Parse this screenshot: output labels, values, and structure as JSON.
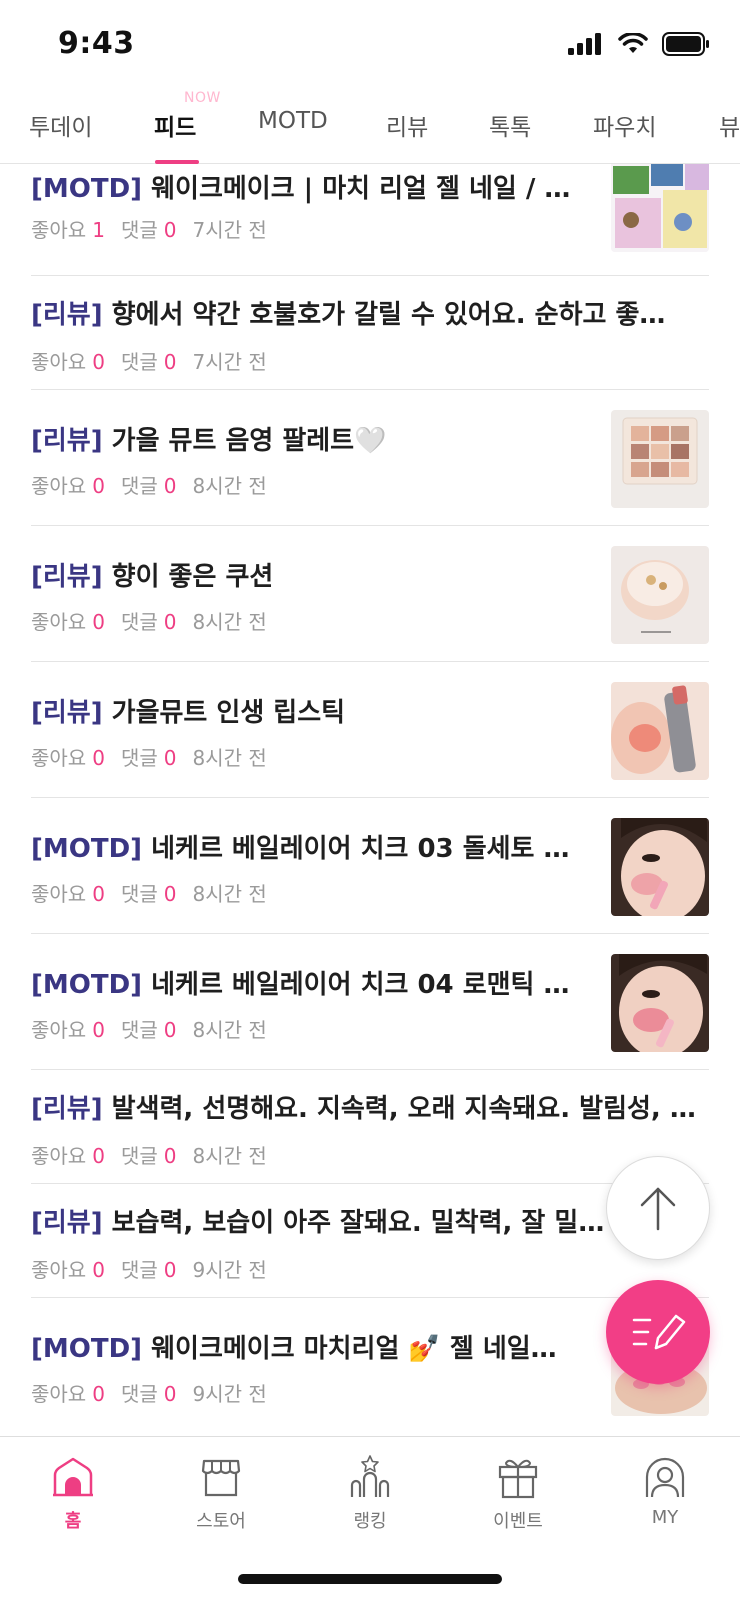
{
  "status_bar": {
    "time": "9:43"
  },
  "top_tabs": [
    {
      "label": "투데이",
      "badge": ""
    },
    {
      "label": "피드",
      "badge": "NOW"
    },
    {
      "label": "MOTD",
      "badge": ""
    },
    {
      "label": "리뷰",
      "badge": ""
    },
    {
      "label": "톡톡",
      "badge": ""
    },
    {
      "label": "파우치",
      "badge": ""
    },
    {
      "label": "뷰",
      "badge": ""
    }
  ],
  "feed": {
    "like_label": "좋아요",
    "comment_label": "댓글",
    "items": [
      {
        "tag": "[MOTD]",
        "title": " 웨이크메이크 | 마치 리얼 젤 네일 / …",
        "likes": "1",
        "comments": "0",
        "time": "7시간 전",
        "thumb": "nail-boxes"
      },
      {
        "tag": "[리뷰]",
        "title": " 향에서 약간 호불호가 갈릴 수 있어요. 순하고 좋…",
        "likes": "0",
        "comments": "0",
        "time": "7시간 전",
        "thumb": ""
      },
      {
        "tag": "[리뷰]",
        "title": " 가을 뮤트 음영 팔레트🤍",
        "likes": "0",
        "comments": "0",
        "time": "8시간 전",
        "thumb": "palette"
      },
      {
        "tag": "[리뷰]",
        "title": " 향이 좋은 쿠션",
        "likes": "0",
        "comments": "0",
        "time": "8시간 전",
        "thumb": "cushion"
      },
      {
        "tag": "[리뷰]",
        "title": " 가을뮤트 인생 립스틱",
        "likes": "0",
        "comments": "0",
        "time": "8시간 전",
        "thumb": "lipstick"
      },
      {
        "tag": "[MOTD]",
        "title": " 네케르 베일레이어 치크 03 돌세토 …",
        "likes": "0",
        "comments": "0",
        "time": "8시간 전",
        "thumb": "face"
      },
      {
        "tag": "[MOTD]",
        "title": " 네케르 베일레이어 치크 04 로맨틱 …",
        "likes": "0",
        "comments": "0",
        "time": "8시간 전",
        "thumb": "face"
      },
      {
        "tag": "[리뷰]",
        "title": " 발색력, 선명해요. 지속력, 오래 지속돼요. 발림성, …",
        "likes": "0",
        "comments": "0",
        "time": "8시간 전",
        "thumb": ""
      },
      {
        "tag": "[리뷰]",
        "title": " 보습력, 보습이 아주 잘돼요. 밀착력, 잘 밀착…",
        "likes": "0",
        "comments": "0",
        "time": "9시간 전",
        "thumb": ""
      },
      {
        "tag": "[MOTD]",
        "title": " 웨이크메이크 마치리얼 💅 젤 네일…",
        "likes": "0",
        "comments": "0",
        "time": "9시간 전",
        "thumb": "hand"
      }
    ]
  },
  "bottom_nav": [
    {
      "label": "홈",
      "icon": "home-icon",
      "active": true
    },
    {
      "label": "스토어",
      "icon": "store-icon",
      "active": false
    },
    {
      "label": "랭킹",
      "icon": "ranking-icon",
      "active": false
    },
    {
      "label": "이벤트",
      "icon": "gift-icon",
      "active": false
    },
    {
      "label": "MY",
      "icon": "profile-icon",
      "active": false
    }
  ],
  "colors": {
    "accent": "#ee3e83",
    "tag": "#3a3683",
    "muted": "#9a9a9a"
  }
}
